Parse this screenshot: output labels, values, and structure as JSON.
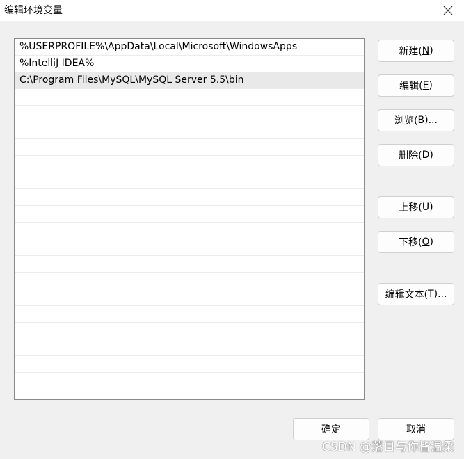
{
  "window": {
    "title": "编辑环境变量",
    "close_icon": "close-icon"
  },
  "list": {
    "entries": [
      "%USERPROFILE%\\AppData\\Local\\Microsoft\\WindowsApps",
      "%IntelliJ IDEA%",
      "C:\\Program Files\\MySQL\\MySQL Server 5.5\\bin"
    ],
    "selected_index": 2
  },
  "buttons": {
    "new": {
      "text": "新建(",
      "key": "N",
      "end": ")"
    },
    "edit": {
      "text": "编辑(",
      "key": "E",
      "end": ")"
    },
    "browse": {
      "text": "浏览(",
      "key": "B",
      "end": ")..."
    },
    "delete": {
      "text": "删除(",
      "key": "D",
      "end": ")"
    },
    "move_up": {
      "text": "上移(",
      "key": "U",
      "end": ")"
    },
    "move_down": {
      "text": "下移(",
      "key": "O",
      "end": ")"
    },
    "edit_text": {
      "text": "编辑文本(",
      "key": "T",
      "end": ")..."
    }
  },
  "footer": {
    "ok": "确定",
    "cancel": "取消"
  },
  "watermark": "CSDN @落日与你皆温柔"
}
